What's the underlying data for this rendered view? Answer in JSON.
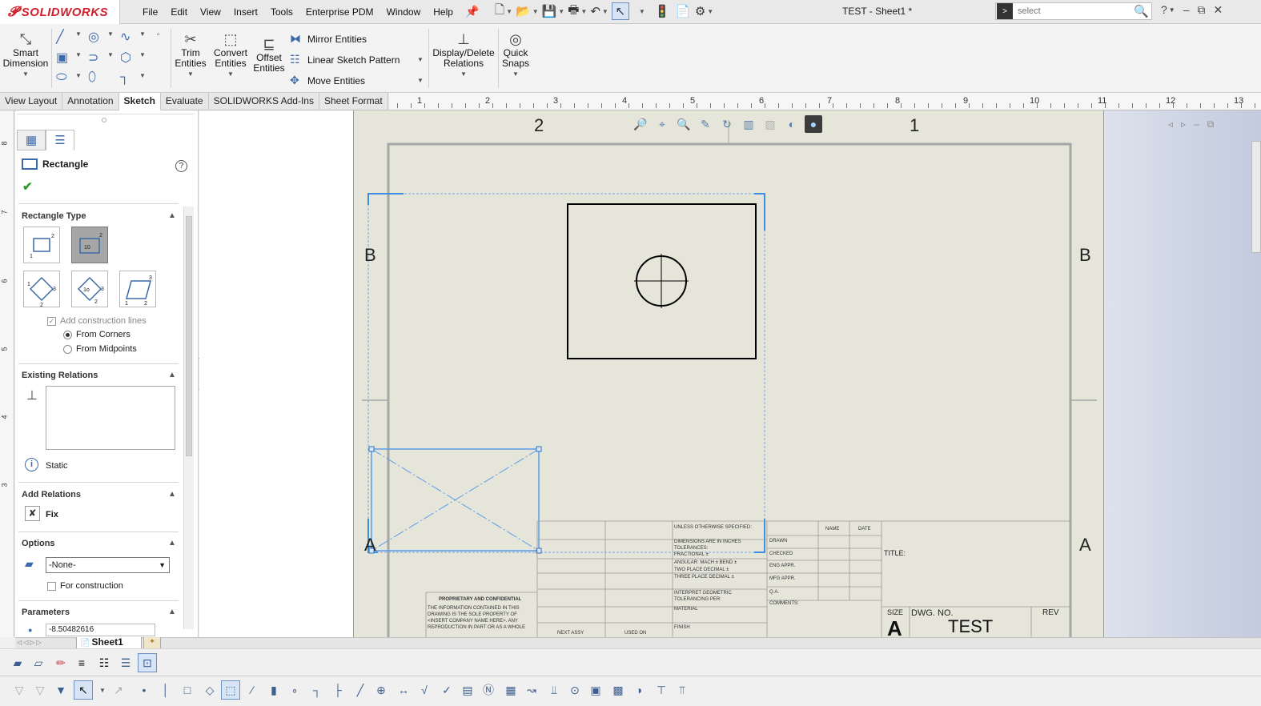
{
  "app": {
    "brand": "SOLIDWORKS",
    "document_title": "TEST - Sheet1 *"
  },
  "menu": [
    "File",
    "Edit",
    "View",
    "Insert",
    "Tools",
    "Enterprise PDM",
    "Window",
    "Help"
  ],
  "search": {
    "placeholder": "select"
  },
  "ribbon": {
    "smart_dimension": "Smart\nDimension",
    "trim_entities": "Trim\nEntities",
    "convert_entities": "Convert\nEntities",
    "offset_entities": "Offset\nEntities",
    "mirror_entities": "Mirror Entities",
    "linear_sketch_pattern": "Linear Sketch Pattern",
    "move_entities": "Move Entities",
    "display_delete_relations": "Display/Delete\nRelations",
    "quick_snaps": "Quick\nSnaps"
  },
  "tabs": [
    "View Layout",
    "Annotation",
    "Sketch",
    "Evaluate",
    "SOLIDWORKS Add-Ins",
    "Sheet Format"
  ],
  "active_tab": "Sketch",
  "ruler": {
    "horizontal": [
      "1",
      "2",
      "3",
      "4",
      "5",
      "6",
      "7",
      "8",
      "9",
      "10",
      "11",
      "12",
      "13"
    ],
    "vertical": [
      "8",
      "7",
      "6",
      "5",
      "4",
      "3"
    ]
  },
  "property_manager": {
    "title": "Rectangle",
    "sections": {
      "rectangle_type": "Rectangle Type",
      "existing_relations": "Existing Relations",
      "add_relations": "Add Relations",
      "options": "Options",
      "parameters": "Parameters"
    },
    "add_construction_lines": "Add construction lines",
    "from_corners": "From Corners",
    "from_midpoints": "From Midpoints",
    "static_label": "Static",
    "fix_label": "Fix",
    "layer_value": "-None-",
    "for_construction": "For construction",
    "param_value": "-8.50482616"
  },
  "drawing": {
    "zone_top_left": "2",
    "zone_top_right": "1",
    "zone_upper_left": "B",
    "zone_upper_right": "B",
    "zone_lower_left": "A",
    "zone_lower_right": "A",
    "title_block": {
      "unless_specified": "UNLESS OTHERWISE SPECIFIED:",
      "name": "NAME",
      "date": "DATE",
      "dimensions": "DIMENSIONS ARE IN INCHES",
      "tolerances": "TOLERANCES:",
      "fractional": "FRACTIONAL ±",
      "angular": "ANGULAR: MACH ±   BEND ±",
      "two_place": "TWO PLACE DECIMAL   ±",
      "three_place": "THREE PLACE DECIMAL   ±",
      "interpret": "INTERPRET GEOMETRIC",
      "tolerancing": "TOLERANCING PER:",
      "material": "MATERIAL",
      "finish": "FINISH",
      "drawn": "DRAWN",
      "checked": "CHECKED",
      "eng_appr": "ENG APPR.",
      "mfg_appr": "MFG APPR.",
      "qa": "Q.A.",
      "comments": "COMMENTS:",
      "title": "TITLE:",
      "size_label": "SIZE",
      "size_value": "A",
      "dwg_no_label": "DWG.  NO.",
      "dwg_no_value": "TEST",
      "rev_label": "REV",
      "proprietary": "PROPRIETARY AND CONFIDENTIAL",
      "prop_line1": "THE INFORMATION CONTAINED IN THIS",
      "prop_line2": "DRAWING IS THE SOLE PROPERTY OF",
      "prop_line3": "<INSERT COMPANY NAME HERE>. ANY",
      "prop_line4": "REPRODUCTION IN PART OR AS A WHOLE",
      "next_assy": "NEXT ASSY",
      "used_on": "USED ON"
    }
  },
  "sheet_tab": "Sheet1"
}
